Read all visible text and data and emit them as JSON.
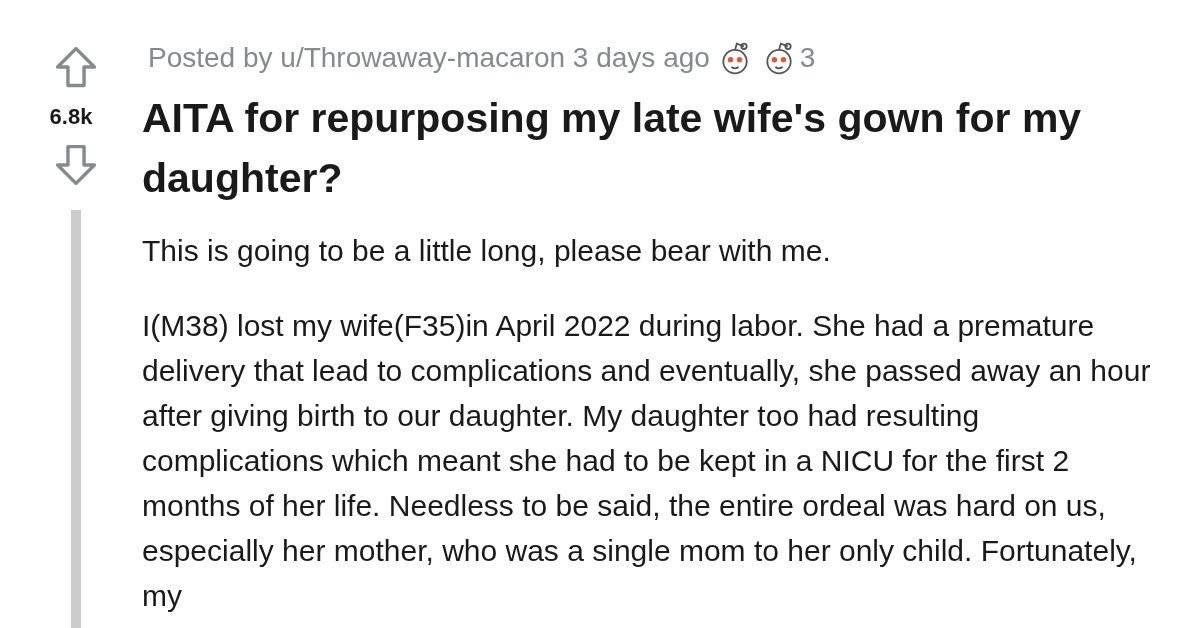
{
  "post": {
    "author_line": "Posted by u/Throwaway-macaron 3 days ago",
    "award_count": "3",
    "score": "6.8k",
    "title": "AITA for repurposing my late wife's gown for my daughter?",
    "paragraphs": [
      "This is going to be a little long, please bear with me.",
      "I(M38) lost my wife(F35)in April 2022 during labor. She had a premature delivery that lead to complications and eventually, she passed away an hour after giving birth to our daughter. My daughter too had resulting complications which meant she had to be kept in a NICU for the first 2 months of her life. Needless to be said, the entire ordeal was hard on us, especially her mother, who was a single mom to her only child. Fortunately, my"
    ]
  }
}
